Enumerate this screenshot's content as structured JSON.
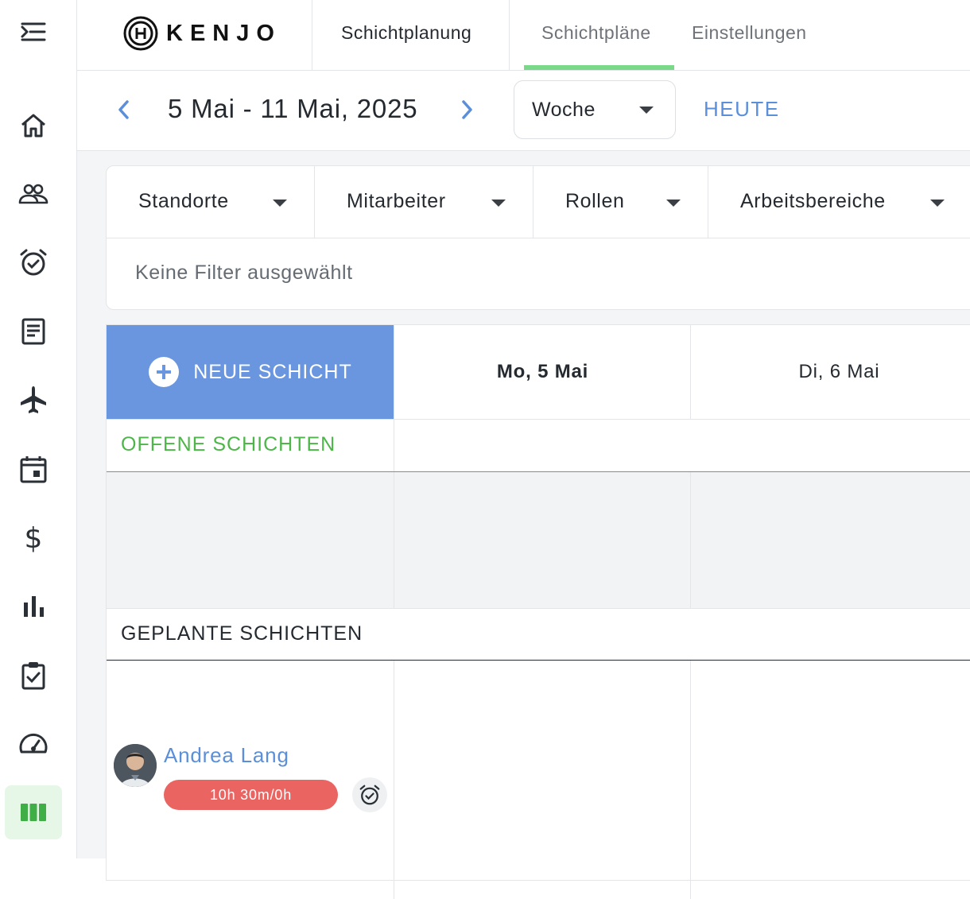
{
  "sidebar": {
    "icons": [
      "menu-expand-icon",
      "home-icon",
      "people-icon",
      "alarm-icon",
      "document-icon",
      "airplane-icon",
      "calendar-icon",
      "dollar-icon",
      "bar-chart-icon",
      "clipboard-check-icon",
      "speedometer-icon",
      "shift-planning-icon"
    ],
    "active": "shift-planning-icon"
  },
  "header": {
    "logo_text": "KENJO",
    "module_title": "Schichtplanung",
    "tabs": [
      {
        "label": "Schichtpläne",
        "active": true
      },
      {
        "label": "Einstellungen",
        "active": false
      }
    ]
  },
  "toolbar": {
    "date_range": "5 Mai - 11 Mai, 2025",
    "view_select": "Woche",
    "today_label": "HEUTE"
  },
  "filters": {
    "items": [
      {
        "label": "Standorte"
      },
      {
        "label": "Mitarbeiter"
      },
      {
        "label": "Rollen"
      },
      {
        "label": "Arbeitsbereiche"
      }
    ],
    "empty_text": "Keine Filter ausgewählt"
  },
  "schedule": {
    "new_shift_label": "NEUE SCHICHT",
    "days": [
      {
        "label": "Mo, 5 Mai",
        "bold": true
      },
      {
        "label": "Di, 6 Mai",
        "bold": false
      }
    ],
    "open_section": "OFFENE SCHICHTEN",
    "planned_section": "GEPLANTE SCHICHTEN",
    "employees": [
      {
        "name": "Andrea Lang",
        "hours": "10h 30m/0h"
      }
    ]
  },
  "colors": {
    "accent_blue": "#6a96df",
    "link_blue": "#5b8fd9",
    "green": "#4cb649",
    "tab_underline": "#7ad88a",
    "hours_red": "#ea6461"
  }
}
